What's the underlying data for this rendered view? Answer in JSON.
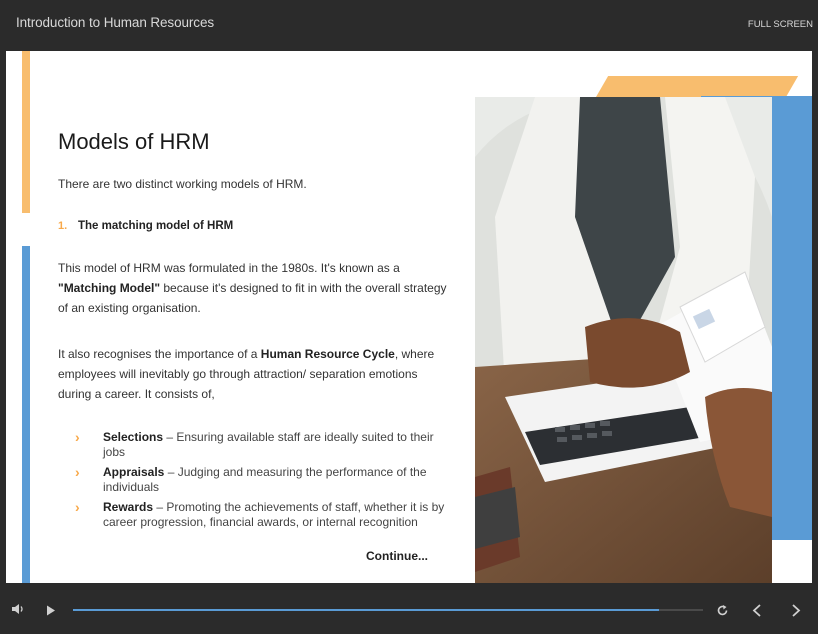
{
  "window": {
    "course_title": "Introduction to Human Resources",
    "fullscreen_label": "FULL SCREEN"
  },
  "slide": {
    "heading": "Models of HRM",
    "intro": "There are two distinct working models of HRM.",
    "subsection": {
      "number": "1.",
      "title": "The matching model of HRM"
    },
    "paragraph1": {
      "part1": "This model of HRM was formulated in the 1980s. It's known as a ",
      "bold": "\"Matching Model\"",
      "part2": " because it's designed to fit in with the overall strategy of an existing organisation."
    },
    "paragraph2": {
      "part1": "It also recognises the importance of a ",
      "bold": "Human Resource Cycle",
      "part2": ", where employees will inevitably go through attraction/ separation emotions during a career. It consists of,"
    },
    "bullets": [
      {
        "term": "Selections",
        "text": " – Ensuring available staff are ideally suited to their jobs"
      },
      {
        "term": "Appraisals",
        "text": " – Judging and measuring the performance of the individuals"
      },
      {
        "term": "Rewards",
        "text": " – Promoting the achievements of staff, whether it is by career progression, financial awards, or internal recognition"
      }
    ],
    "continue_label": "Continue..."
  },
  "player": {
    "progress": 0.93,
    "icons": [
      "volume-icon",
      "play-icon",
      "replay-icon",
      "previous-icon",
      "next-icon"
    ]
  },
  "colors": {
    "accent_orange": "#f8bd6e",
    "accent_blue": "#5a9bd5",
    "chrome_dark": "#2b2b2b"
  }
}
